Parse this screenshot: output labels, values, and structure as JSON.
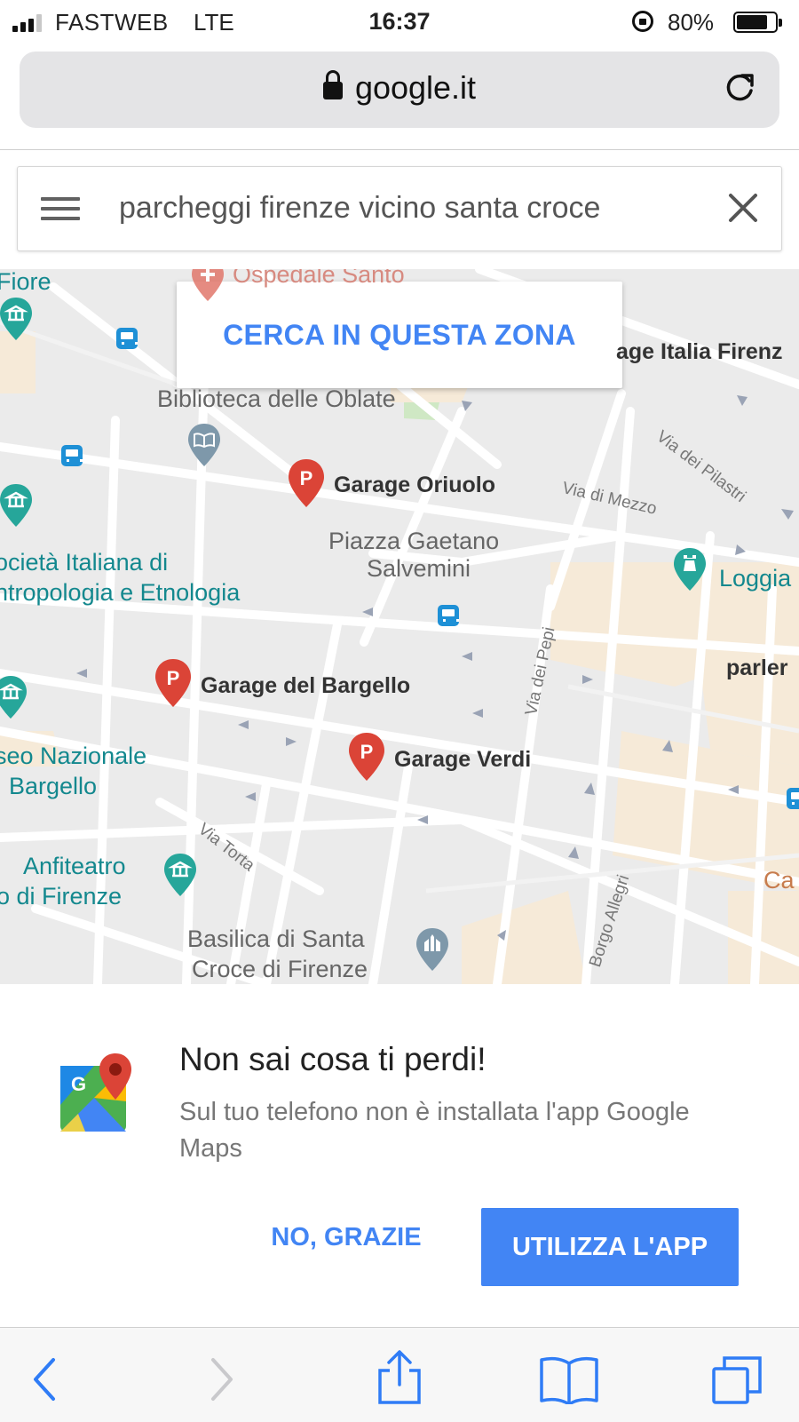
{
  "status_bar": {
    "carrier": "FASTWEB",
    "network": "LTE",
    "time": "16:37",
    "battery_percent": "80%",
    "battery_level": 0.8,
    "signal_bars": 3,
    "signal_bars_total": 4
  },
  "browser": {
    "url": "google.it",
    "icons": {
      "lock": "padlock-icon",
      "reload": "reload-icon"
    }
  },
  "search": {
    "query": "parcheggi firenze vicino santa croce",
    "icons": {
      "menu": "hamburger-menu-icon",
      "clear": "close-icon"
    }
  },
  "map": {
    "search_area_button": "CERCA IN QUESTA ZONA",
    "labels": {
      "fiore": "Fiore",
      "ospedale": "Ospedale Santo",
      "garage_italia": "age Italia Firenz",
      "biblioteca": "Biblioteca delle Oblate",
      "piazza_line1": "Piazza Gaetano",
      "piazza_line2": "Salvemini",
      "societa_line1": "ocietà Italiana di",
      "societa_line2": "ntropologia e Etnologia",
      "loggia": "Loggia",
      "parler": "parler",
      "museo_line1": "seo Nazionale",
      "museo_line2": "Bargello",
      "anfiteatro_line1": "Anfiteatro",
      "anfiteatro_line2": "o di Firenze",
      "basilica_line1": "Basilica di Santa",
      "basilica_line2": "Croce di Firenze",
      "ca": "Ca"
    },
    "streets": {
      "pilastri": "Via dei Pilastri",
      "mezzo": "Via di Mezzo",
      "pepi": "Via dei Pepi",
      "torta": "Via Torta",
      "allegri": "Borgo Allegri"
    },
    "garages": [
      {
        "name": "Garage Oriuolo"
      },
      {
        "name": "Garage del Bargello"
      },
      {
        "name": "Garage Verdi"
      }
    ],
    "colors": {
      "parking_pin": "#db4437",
      "poi_teal": "#26a69a",
      "poi_gray": "#7e98aa",
      "transit": "#1e90d6"
    }
  },
  "dialog": {
    "title": "Non sai cosa ti perdi!",
    "body": "Sul tuo telefono non è installata l'app Google Maps",
    "dismiss_label": "NO, GRAZIE",
    "accept_label": "UTILIZZA L'APP",
    "accent_color": "#4285f4"
  },
  "toolbar": {
    "icons": [
      "back-icon",
      "forward-icon",
      "share-icon",
      "bookmarks-icon",
      "tabs-icon"
    ]
  }
}
